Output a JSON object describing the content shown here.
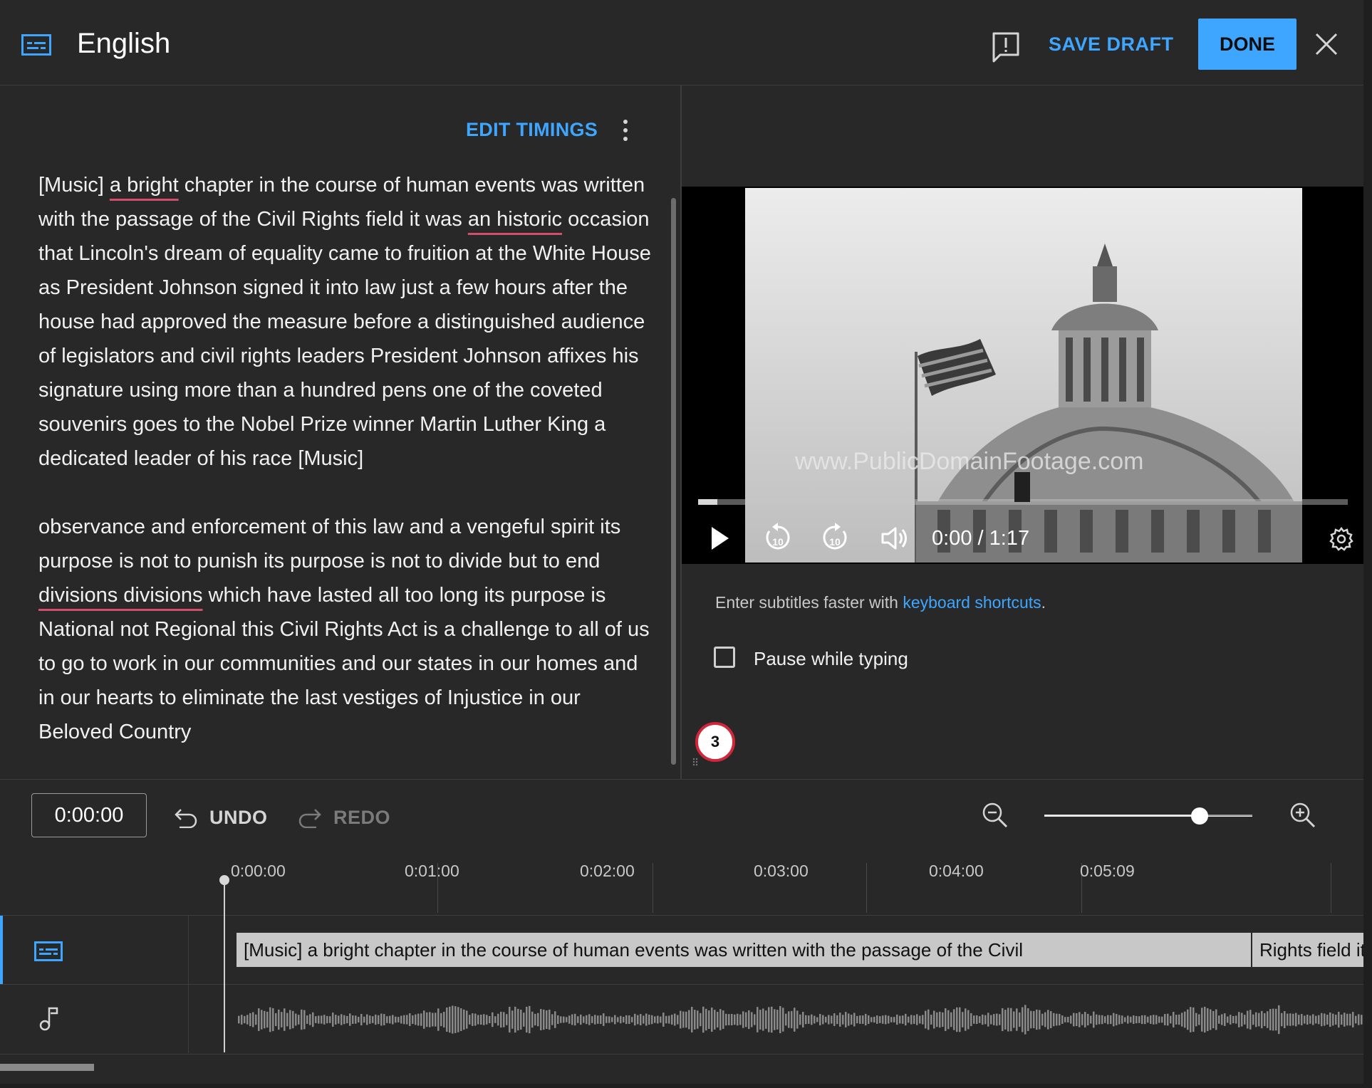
{
  "header": {
    "title": "English",
    "save_draft_label": "SAVE DRAFT",
    "done_label": "DONE",
    "icons": {
      "captions": "captions-icon",
      "feedback": "feedback-icon",
      "close": "close-icon"
    }
  },
  "editor": {
    "edit_timings_label": "EDIT TIMINGS",
    "paragraphs": [
      [
        {
          "t": "[Music] "
        },
        {
          "t": "a bright",
          "spell": true
        },
        {
          "t": " chapter in the course of human events was written with the passage of the Civil Rights field it was "
        },
        {
          "t": "an historic",
          "spell": true
        },
        {
          "t": " occasion that Lincoln's dream of equality came to fruition at the White House as President Johnson signed it into law just a few hours after the house had approved the measure before a distinguished audience of legislators and civil rights leaders President Johnson affixes his signature using more than a hundred pens one of the coveted souvenirs goes to the Nobel Prize winner Martin Luther King a dedicated leader of his race [Music]"
        }
      ],
      [
        {
          "t": "observance and enforcement of this law and a vengeful spirit its purpose is not to punish its purpose is not to divide but to end "
        },
        {
          "t": "divisions divisions",
          "spell": true
        },
        {
          "t": " which have lasted all too long its purpose is National not Regional this Civil Rights Act is a challenge to all of us to go to work in our communities and our states in our homes and in our hearts to eliminate the last vestiges of Injustice in our Beloved Country"
        }
      ]
    ]
  },
  "video": {
    "watermark": "www.PublicDomainFootage.com",
    "current_time": "0:00",
    "duration": "1:17",
    "time_separator": " / ",
    "progress_fraction": 0.03
  },
  "help": {
    "hint_prefix": "Enter subtitles faster with ",
    "hint_link": "keyboard shortcuts",
    "hint_suffix": ".",
    "pause_label": "Pause while typing",
    "pause_checked": false,
    "badge_count": "3"
  },
  "toolbar": {
    "timecode": "0:00:00",
    "undo_label": "UNDO",
    "redo_label": "REDO",
    "zoom_level_fraction": 0.75
  },
  "timeline": {
    "ruler": [
      "0:00:00",
      "0:01:00",
      "0:02:00",
      "0:03:00",
      "0:04:00",
      "0:05:09"
    ],
    "caption_segments": [
      "[Music] a bright chapter in the course of human  events was written with the passage of the Civil",
      "Rights field it"
    ]
  },
  "colors": {
    "accent": "#3ea6ff",
    "background": "#282828",
    "spellcheck_underline": "#d0506b",
    "badge_ring": "#d3263b"
  }
}
